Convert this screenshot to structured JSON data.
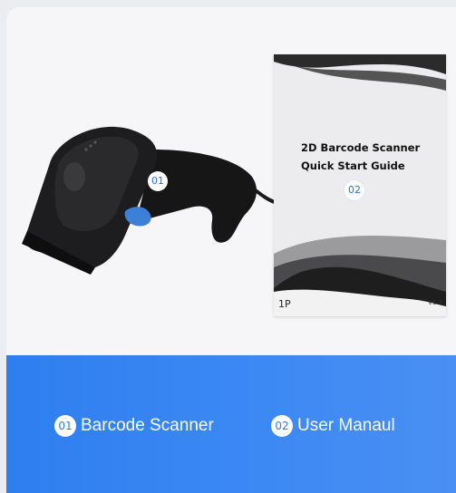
{
  "product_image": {
    "scanner_badge": "01",
    "manual_badge": "02",
    "manual": {
      "title_line1": "2D Barcode Scanner",
      "title_line2": "Quick Start Guide",
      "page": "1P",
      "version": "V1.3"
    }
  },
  "legend": [
    {
      "number": "01",
      "label": "Barcode Scanner"
    },
    {
      "number": "02",
      "label": "User Manaul"
    }
  ],
  "colors": {
    "banner": "#3584f2",
    "badge_text": "#2f6fd8",
    "background": "#f6f6f8"
  },
  "icons": [
    "barcode-scanner-illustration",
    "quick-start-guide-illustration"
  ]
}
